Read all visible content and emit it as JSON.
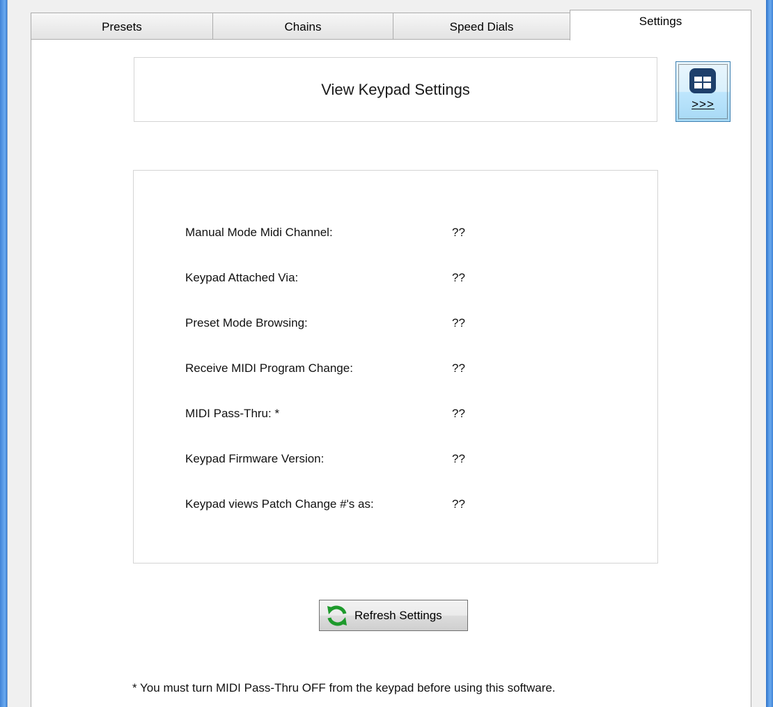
{
  "tabs": [
    {
      "label": "Presets",
      "active": false
    },
    {
      "label": "Chains",
      "active": false
    },
    {
      "label": "Speed Dials",
      "active": false
    },
    {
      "label": "Settings",
      "active": true
    }
  ],
  "header": {
    "title": "View Keypad Settings",
    "expand_button_label": ">>>",
    "expand_button_icon": "grid-table-icon"
  },
  "settings": [
    {
      "label": "Manual Mode Midi Channel:",
      "value": "??"
    },
    {
      "label": "Keypad Attached Via:",
      "value": "??"
    },
    {
      "label": "Preset Mode Browsing:",
      "value": "??"
    },
    {
      "label": "Receive MIDI Program Change:",
      "value": "??"
    },
    {
      "label": "MIDI Pass-Thru: *",
      "value": "??"
    },
    {
      "label": "Keypad Firmware Version:",
      "value": "??"
    },
    {
      "label": "Keypad views Patch Change #'s as:",
      "value": "??"
    }
  ],
  "refresh_button": {
    "label": "Refresh Settings",
    "icon": "refresh-icon"
  },
  "footnote": "* You must turn MIDI Pass-Thru OFF from the keypad before using this software.",
  "colors": {
    "accent": "#3c7fb1",
    "window_frame": "#4a8fdf",
    "refresh_green": "#1e9a2c"
  }
}
